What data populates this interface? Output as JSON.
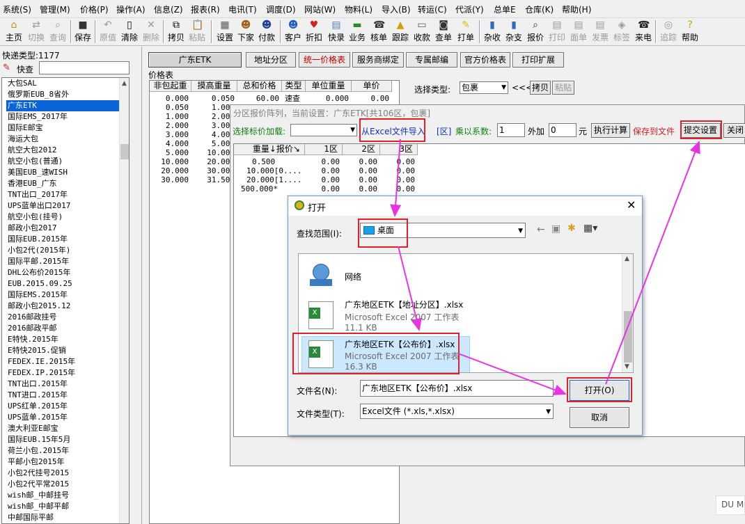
{
  "menu": [
    "系统(S)",
    "管理(M)",
    "价格(P)",
    "操作(A)",
    "信息(Z)",
    "报表(R)",
    "电讯(T)",
    "调度(D)",
    "网站(W)",
    "物料(L)",
    "导入(B)",
    "转运(C)",
    "代派(Y)",
    "总单E",
    "仓库(K)",
    "帮助(H)"
  ],
  "toolbar": {
    "home": "主页",
    "switch": "切换",
    "query": "查询",
    "save": "保存",
    "original": "原值",
    "clear": "清除",
    "delete": "删除",
    "copy": "拷贝",
    "paste": "粘贴",
    "settings": "设置",
    "next": "下家",
    "payment": "付款",
    "customer": "客户",
    "discount": "折扣",
    "quick": "快录",
    "business": "业务",
    "verify": "核单",
    "track": "跟踪",
    "collect": "收款",
    "check_order": "查单",
    "print_order": "打单",
    "misc_income": "杂收",
    "misc_expense": "杂支",
    "quote": "报价",
    "print": "打印",
    "waybill": "面单",
    "invoice": "发票",
    "label": "标签",
    "call": "来电",
    "trace": "追踪",
    "help": "帮助"
  },
  "left_panel": {
    "express_type_label": "快递类型:1177",
    "search_label": "快查",
    "search_value": "",
    "items": [
      "大包SAL",
      "俄罗斯EUB_8省外",
      "广东ETK",
      "国际EMS_2017年",
      "国际E邮宝",
      "海运大包",
      "航空大包2012",
      "航空小包(普通)",
      "美国EUB_速WISH",
      "香港EUB_广东",
      "TNT出口_2017年",
      "UPS蓝单出口2017",
      "航空小包(挂号)",
      "邮政小包2017",
      "国际EUB.2015年",
      "小包2代(2015年)",
      "国际平邮.2015年",
      "DHL公布价2015年",
      "EUB.2015.09.25",
      "国际EMS.2015年",
      "邮政小包2015.12",
      "2016邮政挂号",
      "2016邮政平邮",
      "E特快.2015年",
      "E特快2015.促销",
      "FEDEX.IE.2015年",
      "FEDEX.IP.2015年",
      "TNT出口.2015年",
      "TNT进口.2015年",
      "UPS红单.2015年",
      "UPS蓝单.2015年",
      "澳大利亚E邮宝",
      "国际EUB.15年5月",
      "荷兰小包.2015年",
      "平邮小包2015年",
      "小包2代挂号2015",
      "小包2代平常2015",
      "wish邮_中邮挂号",
      "wish邮_中邮平邮",
      "中邮国际平邮"
    ],
    "selected_index": 2
  },
  "main_buttons": {
    "guangdong_etk": "广东ETK",
    "address_zone": "地址分区",
    "unified_price": "统一价格表",
    "service_bind": "服务商绑定",
    "exclusive_code": "专属邮编",
    "official_price": "官方价格表",
    "print_ext": "打印扩展"
  },
  "price_table": {
    "title": "价格表",
    "headers": [
      "非包起重",
      "摸高重量",
      "总和价格",
      "类型",
      "单位重量",
      "单价"
    ],
    "rows": [
      [
        "0.000",
        "0.050",
        "60.00",
        "速查",
        "0.000",
        "0.00"
      ],
      [
        "0.050",
        "1.000",
        "",
        "",
        "",
        ""
      ],
      [
        "1.000",
        "2.000",
        "",
        "",
        "",
        ""
      ],
      [
        "2.000",
        "3.000",
        "",
        "",
        "",
        ""
      ],
      [
        "3.000",
        "4.000",
        "",
        "",
        "",
        ""
      ],
      [
        "4.000",
        "5.000",
        "",
        "",
        "",
        ""
      ],
      [
        "5.000",
        "10.000",
        "",
        "",
        "",
        ""
      ],
      [
        "10.000",
        "20.000",
        "",
        "",
        "",
        ""
      ],
      [
        "20.000",
        "30.000",
        "",
        "",
        "",
        ""
      ],
      [
        "30.000",
        "31.500",
        "",
        "",
        "",
        ""
      ]
    ]
  },
  "select_type": {
    "label": "选择类型:",
    "value": "包裹",
    "arrows": "<<<",
    "copy": "拷贝",
    "paste": "粘贴"
  },
  "zone_window": {
    "title": "分区报价阵列，当前设置：广东ETK[共106区，包裹]",
    "load_label": "选择标价加载:",
    "load_value": "",
    "import_excel": "从Excel文件导入",
    "zone_tag": "[区]",
    "multiply_label": "乘以系数:",
    "multiply_value": "1",
    "add_label": "外加",
    "add_value": "0",
    "yuan": "元",
    "execute": "执行计算",
    "save_file": "保存到文件",
    "submit": "提交设置",
    "close": "关闭",
    "headers": [
      "重量↓报价↘",
      "1区",
      "2区",
      "3区"
    ],
    "rows": [
      [
        "0.500",
        "0.00",
        "0.00",
        "0.00"
      ],
      [
        "10.000[0....",
        "0.00",
        "0.00",
        "0.00"
      ],
      [
        "20.000[1....",
        "0.00",
        "0.00",
        "0.00"
      ],
      [
        "500.000*",
        "0.00",
        "0.00",
        "0.00"
      ]
    ]
  },
  "open_dialog": {
    "title": "打开",
    "lookin_label": "查找范围(I):",
    "lookin_value": "桌面",
    "files": [
      {
        "name": "网络",
        "type": "",
        "size": ""
      },
      {
        "name": "广东地区ETK【地址分区】.xlsx",
        "type": "Microsoft Excel 2007 工作表",
        "size": "11.1 KB"
      },
      {
        "name": "广东地区ETK【公布价】.xlsx",
        "type": "Microsoft Excel 2007 工作表",
        "size": "16.3 KB"
      }
    ],
    "filename_label": "文件名(N):",
    "filename_value": "广东地区ETK【公布价】.xlsx",
    "filetype_label": "文件类型(T):",
    "filetype_value": "Excel文件 (*.xls,*.xlsx)",
    "open_button": "打开(O)",
    "cancel_button": "取消"
  },
  "corner_overlay": "DU M",
  "colors": {
    "highlight_red": "#e0202a",
    "arrow_magenta": "#e834e0",
    "selection_blue": "#0a64d8",
    "dialog_selection": "#cce8ff"
  }
}
